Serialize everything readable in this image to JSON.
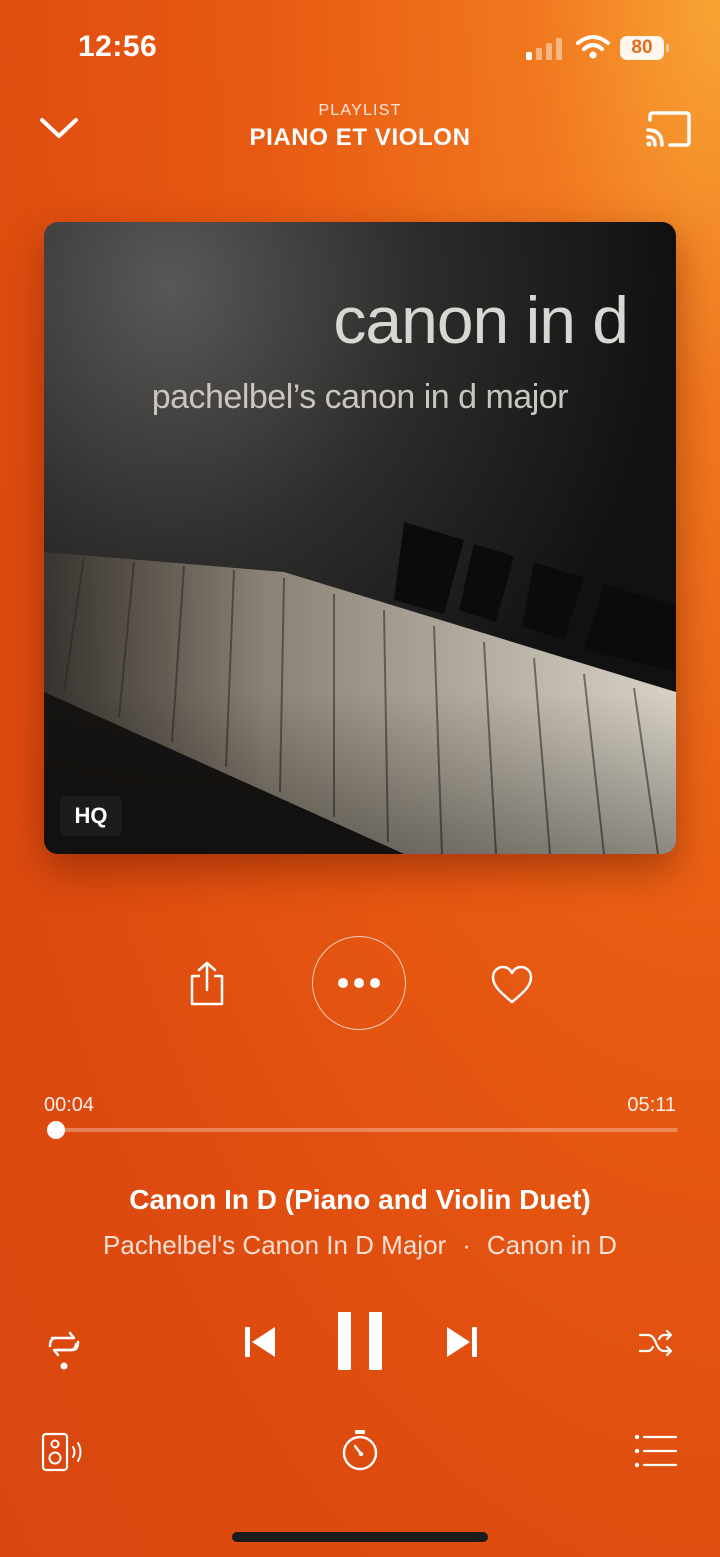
{
  "status_bar": {
    "time": "12:56",
    "battery": "80"
  },
  "header": {
    "eyebrow": "PLAYLIST",
    "title": "PIANO ET VIOLON"
  },
  "artwork": {
    "title": "canon in d",
    "subtitle": "pachelbel’s canon in d major",
    "badge": "HQ"
  },
  "progress": {
    "elapsed": "00:04",
    "duration": "05:11",
    "fraction": 0.0129
  },
  "track": {
    "title": "Canon In D (Piano and Violin Duet)",
    "album": "Pachelbel's Canon In D Major",
    "separator": "·",
    "artist": "Canon in D"
  },
  "icons": {
    "collapse": "chevron-down-icon",
    "cast": "cast-icon",
    "share": "share-icon",
    "more": "more-icon",
    "like": "heart-icon",
    "repeat": "repeat-icon",
    "previous": "skip-previous-icon",
    "pause": "pause-icon",
    "next": "skip-next-icon",
    "shuffle": "shuffle-icon",
    "device": "speaker-icon",
    "timer": "sleep-timer-icon",
    "queue": "queue-list-icon"
  },
  "colors": {
    "accent": "#e85a12",
    "highlight": "#f8a535"
  }
}
